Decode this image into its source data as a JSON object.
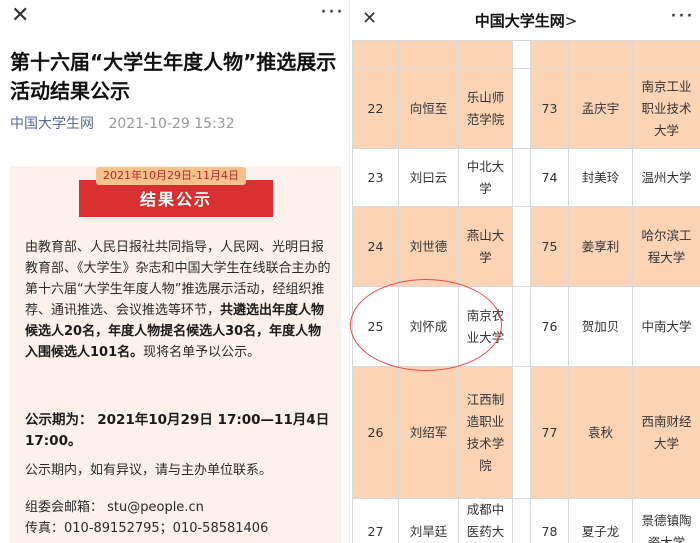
{
  "left": {
    "close_icon": "✕",
    "more_icon": "···",
    "title": "第十六届“大学生年度人物”推选展示活动结果公示",
    "source": "中国大学生网",
    "date": "2021-10-29 15:32",
    "period_pill": "2021年10月29日-11月4日",
    "banner": "结果公示",
    "p1_normal": "由教育部、人民日报社共同指导，人民网、光明日报教育部、《大学生》杂志和中国大学生在线联合主办的第十六届“大学生年度人物”推选展示活动，经组织推荐、通讯推选、会议推选等环节，",
    "p1_bold": "共遴选出年度人物候选人20名，年度人物提名候选人30名，年度人物入围候选人101名。",
    "p1_tail": "现将名单予以公示。",
    "p2": "公示期为： 2021年10月29日 17:00—11月4日 17:00。",
    "p3": "公示期内，如有异议，请与主办单位联系。",
    "p4_mail": "组委会邮箱： stu@people.cn",
    "p4_phone": "传真：010-89152795；010-58581406"
  },
  "right": {
    "close_icon": "✕",
    "more_icon": "···",
    "title": "中国大学生网",
    "title_chevron": ">",
    "rows": [
      {
        "n1": "",
        "name1": "",
        "school1": "",
        "n2": "",
        "name2": "",
        "school2": ""
      },
      {
        "n1": "22",
        "name1": "向恒至",
        "school1": "乐山师范学院",
        "n2": "73",
        "name2": "孟庆宇",
        "school2": "南京工业职业技术大学"
      },
      {
        "n1": "23",
        "name1": "刘曰云",
        "school1": "中北大学",
        "n2": "74",
        "name2": "封美玲",
        "school2": "温州大学"
      },
      {
        "n1": "24",
        "name1": "刘世德",
        "school1": "燕山大学",
        "n2": "75",
        "name2": "姜享利",
        "school2": "哈尔滨工程大学"
      },
      {
        "n1": "25",
        "name1": "刘怀成",
        "school1": "南京农业大学",
        "n2": "76",
        "name2": "贺加贝",
        "school2": "中南大学"
      },
      {
        "n1": "26",
        "name1": "刘绍军",
        "school1": "江西制造职业技术学院",
        "n2": "77",
        "name2": "袁秋",
        "school2": "西南财经大学"
      },
      {
        "n1": "27",
        "name1": "刘旱廷",
        "school1": "成都中医药大学",
        "n2": "78",
        "name2": "夏子龙",
        "school2": "景德镇陶瓷大学"
      }
    ]
  }
}
